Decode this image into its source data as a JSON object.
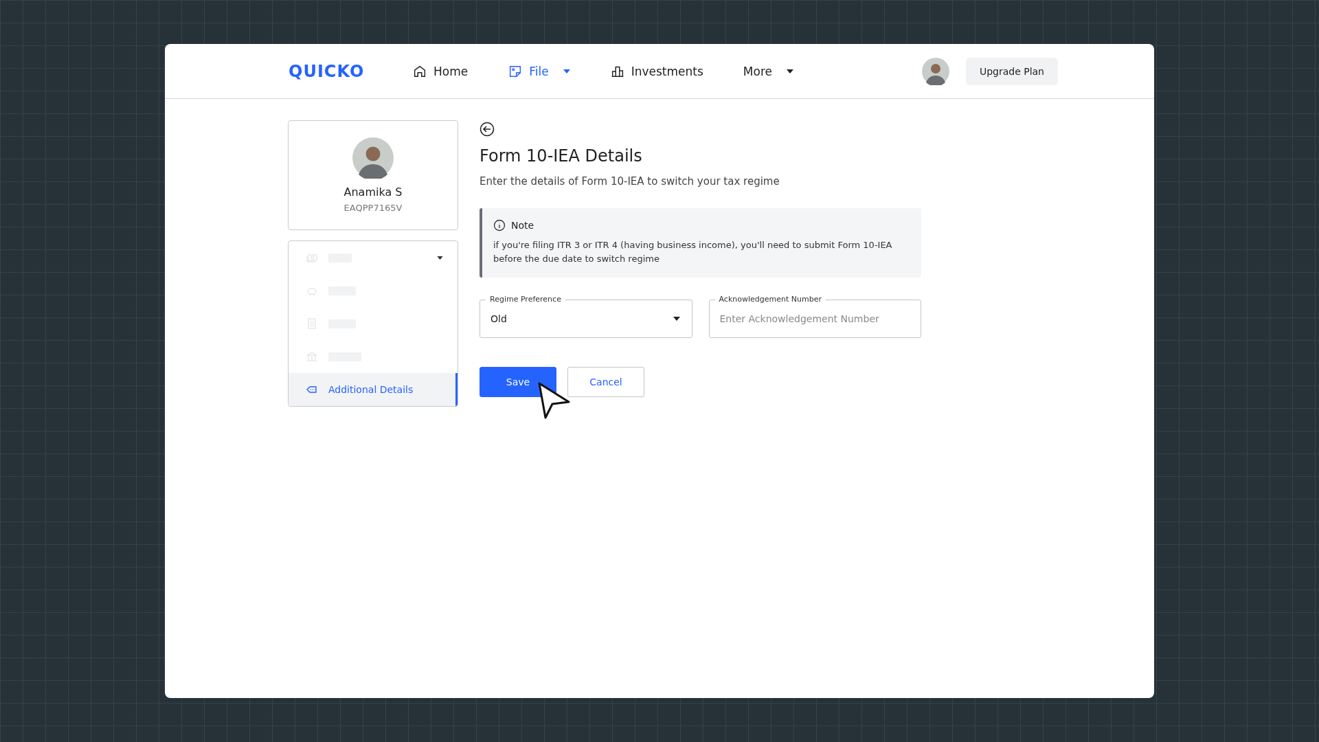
{
  "header": {
    "logo": "QUICKO",
    "nav": [
      {
        "label": "Home",
        "selected": false,
        "dropdown": false
      },
      {
        "label": "File",
        "selected": true,
        "dropdown": true
      },
      {
        "label": "Investments",
        "selected": false,
        "dropdown": false
      },
      {
        "label": "More",
        "selected": false,
        "dropdown": true
      }
    ],
    "upgrade_button": "Upgrade Plan"
  },
  "profile": {
    "name": "Anamika S",
    "pan": "EAQPP7165V"
  },
  "sidebar": {
    "items": [
      {
        "kind": "group",
        "selected": false
      },
      {
        "kind": "placeholder",
        "selected": false
      },
      {
        "kind": "placeholder",
        "selected": false
      },
      {
        "kind": "placeholder",
        "selected": false
      },
      {
        "kind": "link",
        "label": "Additional Details",
        "selected": true
      }
    ]
  },
  "form": {
    "title": "Form 10-IEA Details",
    "subtitle": "Enter the details of Form 10-IEA to switch your tax regime",
    "note": {
      "title": "Note",
      "text": "if you're filing ITR 3 or ITR 4  (having business income), you'll need to submit Form 10-IEA before the due date to switch regime"
    },
    "fields": [
      {
        "kind": "select",
        "label": "Regime Preference",
        "value": "Old"
      },
      {
        "kind": "text",
        "label": "Acknowledgement Number",
        "placeholder": "Enter Acknowledgement Number"
      }
    ],
    "buttons": [
      {
        "kind": "primary",
        "label": "Save"
      },
      {
        "kind": "secondary",
        "label": "Cancel"
      }
    ]
  }
}
